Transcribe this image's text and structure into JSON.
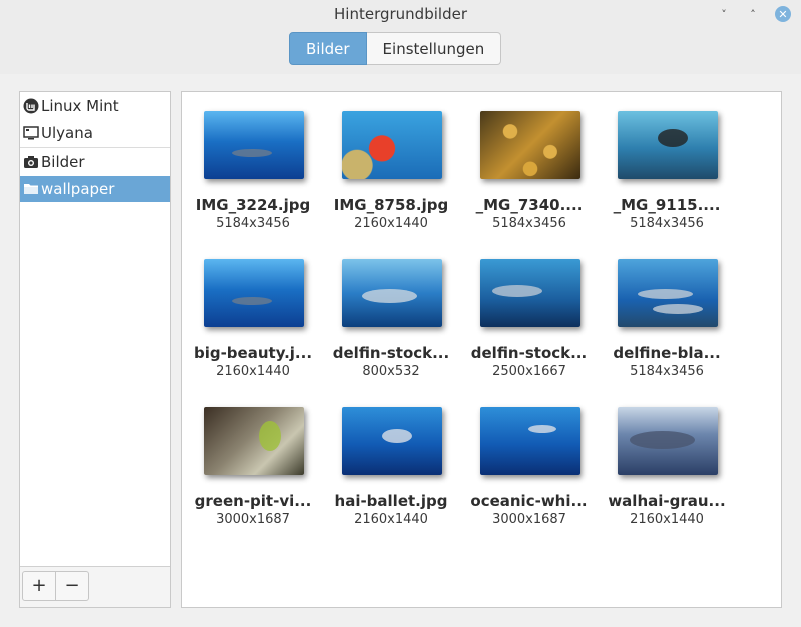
{
  "window": {
    "title": "Hintergrundbilder",
    "minimize_glyph": "˅",
    "maximize_glyph": "˄",
    "close_glyph": "✕"
  },
  "tabs": [
    {
      "label": "Bilder",
      "active": true
    },
    {
      "label": "Einstellungen",
      "active": false
    }
  ],
  "sidebar": {
    "items": [
      {
        "label": "Linux Mint",
        "icon": "linux-mint-logo-icon"
      },
      {
        "label": "Ulyana",
        "icon": "monitor-icon"
      },
      {
        "label": "Bilder",
        "icon": "camera-icon"
      },
      {
        "label": "wallpaper",
        "icon": "folder-icon",
        "selected": true
      }
    ],
    "add_label": "+",
    "remove_label": "−"
  },
  "images": [
    {
      "name": "IMG_3224.jpg",
      "size": "5184x3456"
    },
    {
      "name": "IMG_8758.jpg",
      "size": "2160x1440"
    },
    {
      "name": "_MG_7340....",
      "size": "5184x3456"
    },
    {
      "name": "_MG_9115....",
      "size": "5184x3456"
    },
    {
      "name": "big-beauty.j...",
      "size": "2160x1440"
    },
    {
      "name": "delfin-stock...",
      "size": "800x532"
    },
    {
      "name": "delfin-stock...",
      "size": "2500x1667"
    },
    {
      "name": "delfine-bla...",
      "size": "5184x3456"
    },
    {
      "name": "green-pit-vi...",
      "size": "3000x1687"
    },
    {
      "name": "hai-ballet.jpg",
      "size": "2160x1440"
    },
    {
      "name": "oceanic-whi...",
      "size": "3000x1687"
    },
    {
      "name": "walhai-grau...",
      "size": "2160x1440"
    }
  ],
  "colors": {
    "accent": "#6aa6d6",
    "close_button": "#7eb3dd"
  }
}
